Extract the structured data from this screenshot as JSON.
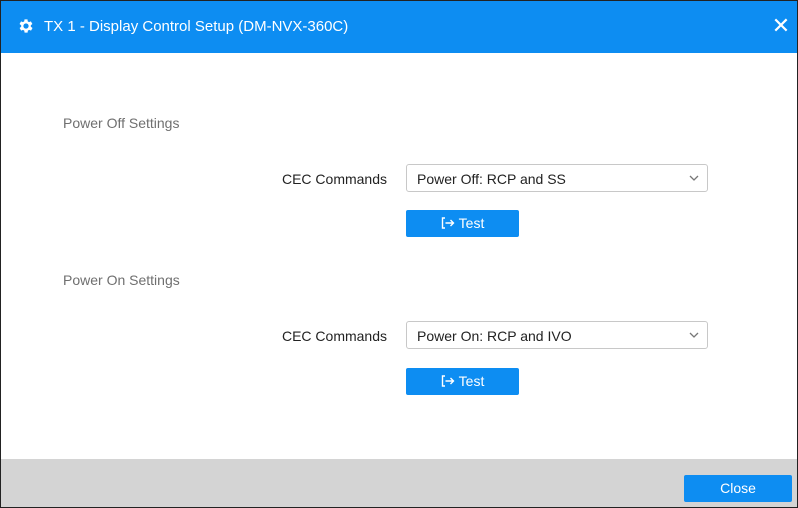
{
  "dialog": {
    "title": "TX 1 - Display Control Setup (DM-NVX-360C)",
    "title_icon": "gear-icon",
    "close_icon": "close-icon",
    "close_glyph": "✕",
    "accent_color": "#0d8df2"
  },
  "power_off": {
    "section_title": "Power Off Settings",
    "label": "CEC Commands",
    "selected_value": "Power Off: RCP and SS",
    "test_label": "Test",
    "test_icon": "sign-in-arrow-icon"
  },
  "power_on": {
    "section_title": "Power On Settings",
    "label": "CEC Commands",
    "selected_value": "Power On: RCP and IVO",
    "test_label": "Test",
    "test_icon": "sign-in-arrow-icon"
  },
  "footer": {
    "close_label": "Close"
  }
}
